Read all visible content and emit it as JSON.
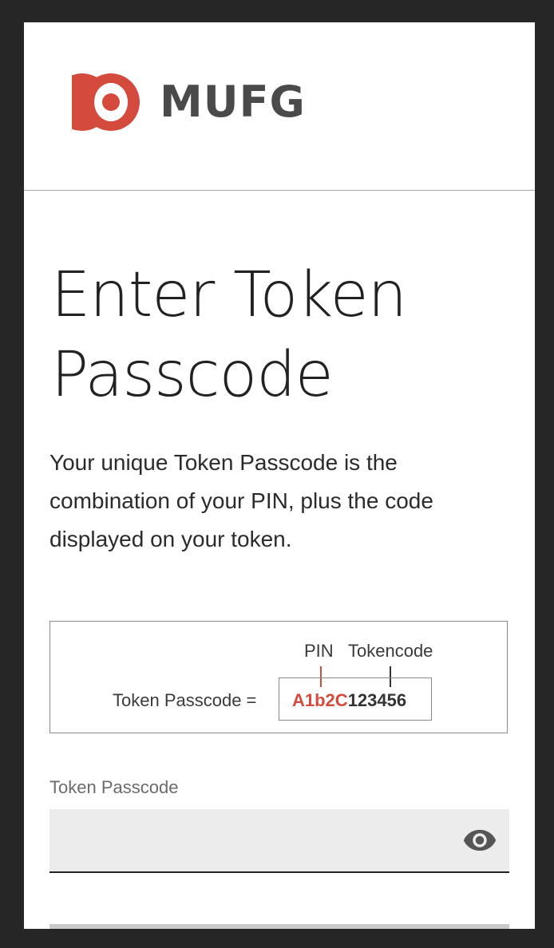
{
  "brand": {
    "logo_text": "MUFG",
    "logo_color": "#d44a3c",
    "text_color": "#4a4a4a"
  },
  "page": {
    "title_line1": "Enter Token",
    "title_line2": "Passcode",
    "description": "Your unique Token Passcode is the combination of your PIN, plus the code displayed on your token."
  },
  "diagram": {
    "pin_label": "PIN",
    "tokencode_label": "Tokencode",
    "equation_label": "Token Passcode =",
    "pin_example": "A1b2C",
    "tokencode_example": "123456",
    "pin_color": "#d44a3c"
  },
  "form": {
    "passcode_label": "Token Passcode",
    "passcode_value": "",
    "toggle_icon": "eye-icon"
  }
}
